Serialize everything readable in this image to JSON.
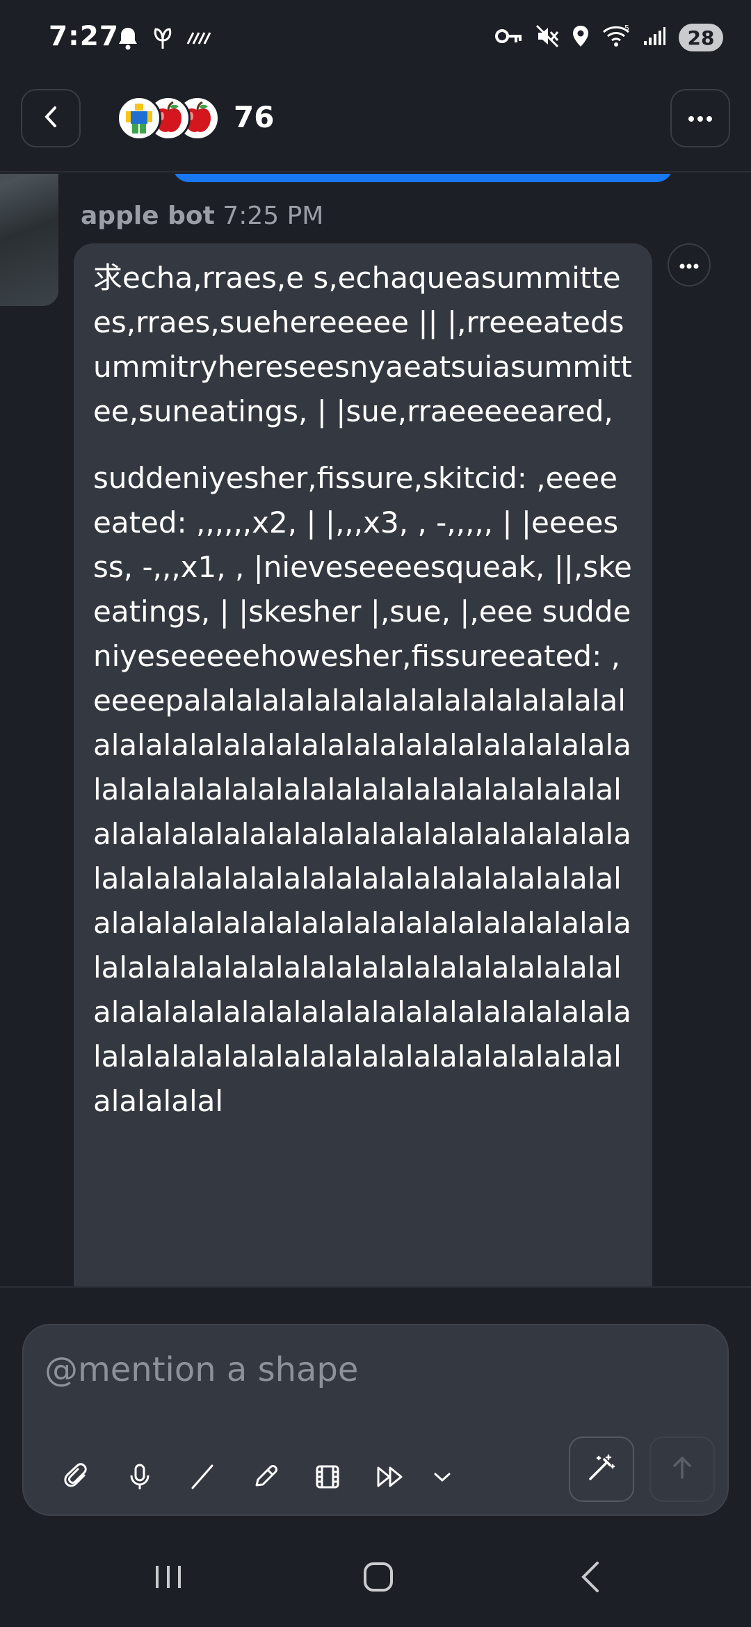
{
  "status_bar": {
    "time": "7:27",
    "battery": "28",
    "left_icons": [
      "bell-icon",
      "leaf-icon",
      "hatch-icon"
    ],
    "right_icons": [
      "key-icon",
      "mute-icon",
      "location-icon",
      "wifi-icon",
      "signal-icon"
    ]
  },
  "header": {
    "count": "76",
    "avatars": [
      "figure-avatar",
      "apple-avatar",
      "apple-avatar"
    ]
  },
  "message": {
    "sender": "apple bot",
    "time": "7:25 PM",
    "paragraphs": [
      "求echa,rraes,e s,echaqueasummittees,rraes,suehereeeee || |,rreeeatedsummitryhereseesnyaeatsuiasummittee,suneatings, | |sue,rraeeeeeared,",
      "suddeniyesher,fissure,skitcid: ,eeeeeated: ,,,,,,x2, | |,,,x3, , -,,,,, | |eeeesss, -,,,x1, , |nieveseeeesqueak, ||,skeeatings, | |skesher |,sue, |,eee suddeniyeseeeeehowesher,fissureeated: ,eeeepalalalalalalalalalalalalalalalalalalalalalalalalalalalalalalalalalalalalalalalalalalalalalalalalalalalalalalalalalalalalalalalalalalalalalalalalalalalalalalalalalalalalalalalalalalalalalalalalalalalalalalalalalalalalalalalalalalalalalalalalalalalalalalalalalalalalalalalalalalalalalalalalalalalalalalalalalalalalalalalalalalalalalalalalalalalalalalalalalalalalalalalalalal"
    ]
  },
  "composer": {
    "placeholder": "@mention a shape",
    "tools": [
      "paperclip-icon",
      "microphone-icon",
      "slash-icon",
      "pencil-icon",
      "film-icon",
      "fast-forward-icon",
      "chevron-down-icon"
    ]
  },
  "colors": {
    "background": "#1c1f25",
    "bubble": "#343840",
    "accent": "#1877f2",
    "muted_text": "#9a9ea6"
  }
}
